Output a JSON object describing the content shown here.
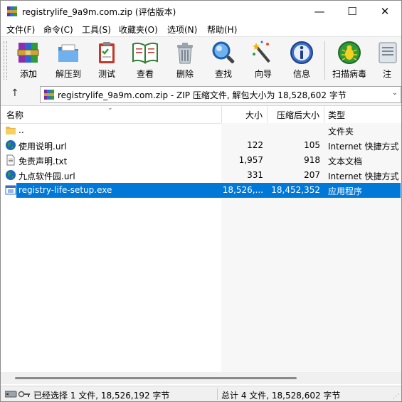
{
  "window": {
    "title": "registrylife_9a9m.com.zip (评估版本)",
    "controls": {
      "minimize": "—",
      "maximize": "☐",
      "close": "✕"
    }
  },
  "menu": [
    {
      "label": "文件(F)"
    },
    {
      "label": "命令(C)"
    },
    {
      "label": "工具(S)"
    },
    {
      "label": "收藏夹(O)"
    },
    {
      "label": "选项(N)"
    },
    {
      "label": "帮助(H)"
    }
  ],
  "toolbar": [
    {
      "label": "添加",
      "icon": "add-archive-icon"
    },
    {
      "label": "解压到",
      "icon": "extract-folder-icon"
    },
    {
      "label": "测试",
      "icon": "test-clipboard-icon"
    },
    {
      "label": "查看",
      "icon": "view-book-icon"
    },
    {
      "label": "删除",
      "icon": "trash-icon"
    },
    {
      "label": "查找",
      "icon": "magnifier-icon"
    },
    {
      "label": "向导",
      "icon": "wizard-wand-icon"
    },
    {
      "label": "信息",
      "icon": "info-icon"
    },
    {
      "label": "扫描病毒",
      "icon": "virus-scan-icon"
    },
    {
      "label": "注",
      "icon": "comment-icon"
    }
  ],
  "address": {
    "up_icon": "↑",
    "text": "registrylife_9a9m.com.zip - ZIP 压缩文件, 解包大小为 18,528,602 字节",
    "dropdown_icon": "⌄"
  },
  "columns": {
    "name": "名称",
    "size": "大小",
    "packed": "压缩后大小",
    "type": "类型"
  },
  "files": [
    {
      "name": "..",
      "size": "",
      "packed": "",
      "type": "文件夹",
      "icon": "folder-icon",
      "selected": false
    },
    {
      "name": "使用说明.url",
      "size": "122",
      "packed": "105",
      "type": "Internet 快捷方式",
      "icon": "globe-icon",
      "selected": false
    },
    {
      "name": "免责声明.txt",
      "size": "1,957",
      "packed": "918",
      "type": "文本文档",
      "icon": "text-file-icon",
      "selected": false
    },
    {
      "name": "九点软件园.url",
      "size": "331",
      "packed": "207",
      "type": "Internet 快捷方式",
      "icon": "globe-icon",
      "selected": false
    },
    {
      "name": "registry-life-setup.exe",
      "size": "18,526,...",
      "packed": "18,452,352",
      "type": "应用程序",
      "icon": "exe-icon",
      "selected": true
    }
  ],
  "status": {
    "left": "已经选择 1 文件, 18,526,192 字节",
    "right": "总计 4 文件, 18,528,602 字节"
  },
  "colors": {
    "selection": "#0078d7",
    "toolbar_bg": "#f5f5f5"
  }
}
